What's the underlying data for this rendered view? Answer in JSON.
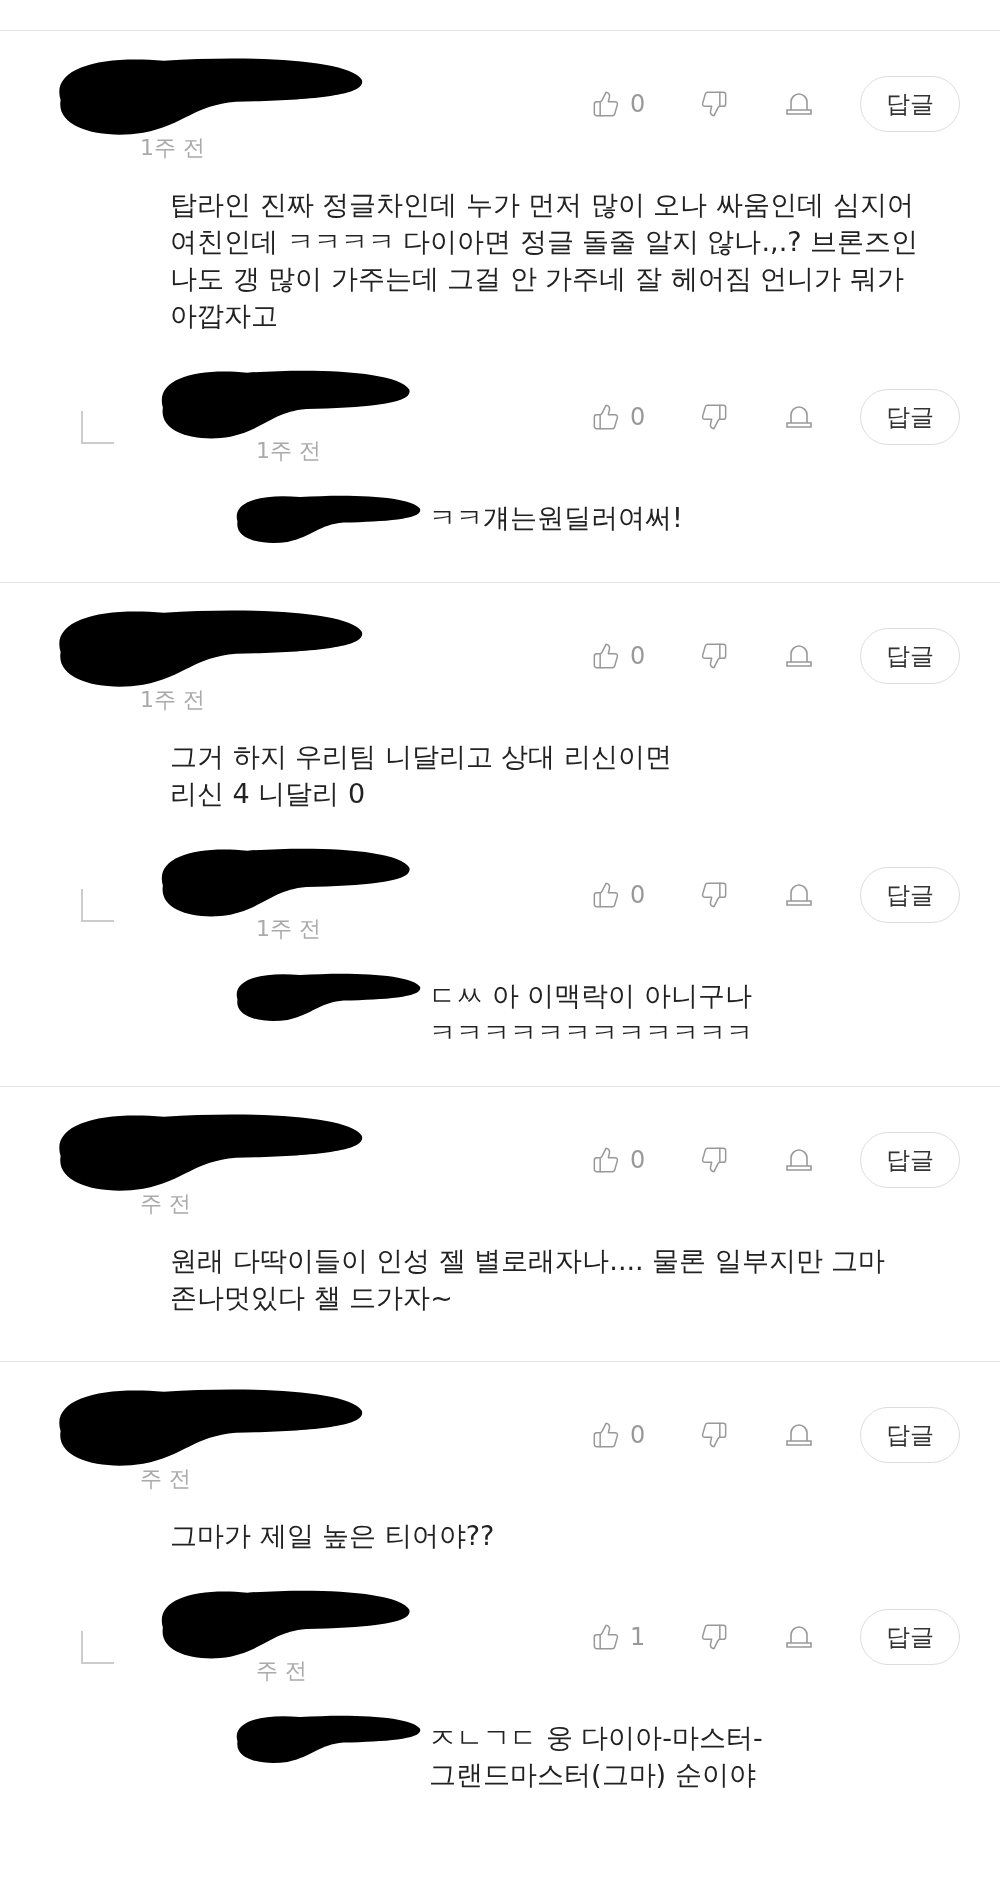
{
  "threads": [
    {
      "comment": {
        "time": "1주 전",
        "likes": "0",
        "reply_button": "답글",
        "body": "탑라인 진짜 정글차인데 누가 먼저 많이 오나 싸움인데 심지어\n여친인데 ㅋㅋㅋㅋ 다이아면 정글 돌줄 알지 않나.,.? 브론즈인\n나도 갱 많이 가주는데 그걸 안 가주네 잘 헤어짐 언니가 뭐가\n아깝자고"
      },
      "replies": [
        {
          "time": "1주 전",
          "likes": "0",
          "reply_button": "답글",
          "body": "ㅋㅋ걔는원딜러여써!"
        }
      ]
    },
    {
      "comment": {
        "time": "1주 전",
        "likes": "0",
        "reply_button": "답글",
        "body": "그거 하지 우리팀 니달리고 상대 리신이면\n리신 4 니달리 0"
      },
      "replies": [
        {
          "time": "1주 전",
          "likes": "0",
          "reply_button": "답글",
          "body": "ㄷㅆ 아 이맥락이 아니구나\nㅋㅋㅋㅋㅋㅋㅋㅋㅋㅋㅋㅋ"
        }
      ]
    },
    {
      "comment": {
        "time": "주 전",
        "likes": "0",
        "reply_button": "답글",
        "body": "원래 다딱이들이 인성 젤 별로래자나.... 물론 일부지만 그마\n존나멋있다 챌 드가자~"
      }
    },
    {
      "comment": {
        "time": "주 전",
        "likes": "0",
        "reply_button": "답글",
        "body": "그마가 제일 높은 티어야??"
      },
      "replies": [
        {
          "time": "주 전",
          "likes": "1",
          "reply_button": "답글",
          "body": "ㅈㄴㄱㄷ 웅 다이아-마스터-\n그랜드마스터(그마) 순이야"
        }
      ]
    }
  ]
}
